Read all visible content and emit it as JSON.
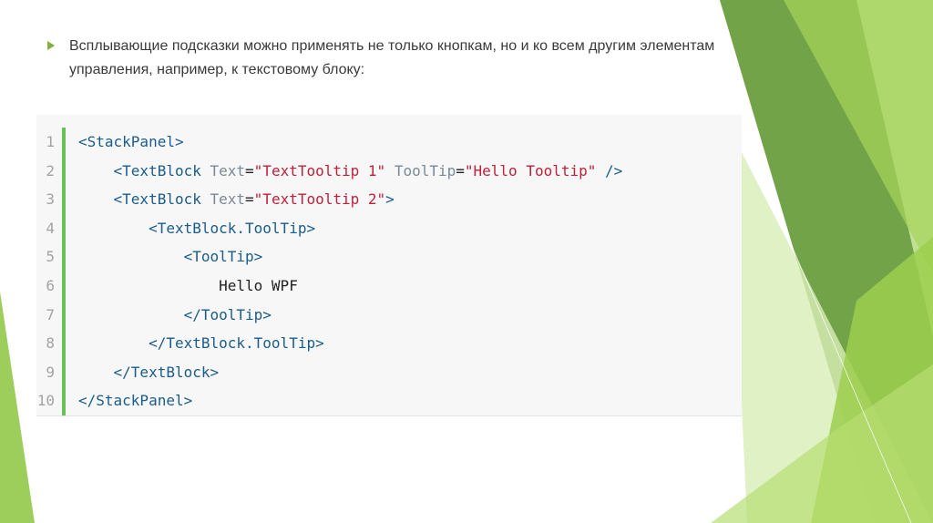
{
  "slide": {
    "bullet_text": "Всплывающие подсказки можно применять не только кнопкам, но и ко всем другим элементам управления, например, к текстовому блоку:"
  },
  "code": {
    "lines": [
      {
        "num": "1",
        "indent": "",
        "parts": [
          {
            "t": "tag",
            "s": "<StackPanel>"
          }
        ]
      },
      {
        "num": "2",
        "indent": "    ",
        "parts": [
          {
            "t": "tag",
            "s": "<TextBlock"
          },
          {
            "t": "txt",
            "s": " "
          },
          {
            "t": "attr",
            "s": "Text"
          },
          {
            "t": "txt",
            "s": "="
          },
          {
            "t": "val",
            "s": "\"TextTooltip 1\""
          },
          {
            "t": "txt",
            "s": " "
          },
          {
            "t": "attr",
            "s": "ToolTip"
          },
          {
            "t": "txt",
            "s": "="
          },
          {
            "t": "val",
            "s": "\"Hello Tooltip\""
          },
          {
            "t": "txt",
            "s": " "
          },
          {
            "t": "tag",
            "s": "/>"
          }
        ]
      },
      {
        "num": "3",
        "indent": "    ",
        "parts": [
          {
            "t": "tag",
            "s": "<TextBlock"
          },
          {
            "t": "txt",
            "s": " "
          },
          {
            "t": "attr",
            "s": "Text"
          },
          {
            "t": "txt",
            "s": "="
          },
          {
            "t": "val",
            "s": "\"TextTooltip 2\""
          },
          {
            "t": "tag",
            "s": ">"
          }
        ]
      },
      {
        "num": "4",
        "indent": "        ",
        "parts": [
          {
            "t": "tag",
            "s": "<TextBlock.ToolTip>"
          }
        ]
      },
      {
        "num": "5",
        "indent": "            ",
        "parts": [
          {
            "t": "tag",
            "s": "<ToolTip>"
          }
        ]
      },
      {
        "num": "6",
        "indent": "                ",
        "parts": [
          {
            "t": "txt",
            "s": "Hello WPF"
          }
        ]
      },
      {
        "num": "7",
        "indent": "            ",
        "parts": [
          {
            "t": "tag",
            "s": "</ToolTip>"
          }
        ]
      },
      {
        "num": "8",
        "indent": "        ",
        "parts": [
          {
            "t": "tag",
            "s": "</TextBlock.ToolTip>"
          }
        ]
      },
      {
        "num": "9",
        "indent": "    ",
        "parts": [
          {
            "t": "tag",
            "s": "</TextBlock>"
          }
        ]
      },
      {
        "num": "10",
        "indent": "",
        "parts": [
          {
            "t": "tag",
            "s": "</StackPanel>"
          }
        ]
      }
    ]
  },
  "colors": {
    "accent_green": "#7fb13b",
    "gutter_green": "#6bbf59",
    "tag_blue": "#1a5c8c",
    "string_red": "#c0213a"
  }
}
